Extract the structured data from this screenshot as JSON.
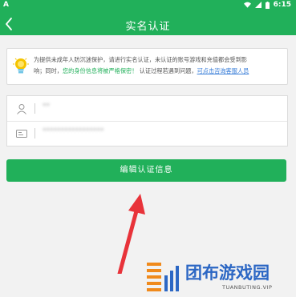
{
  "status_bar": {
    "app_indicator": "A",
    "time": "6:15",
    "icons": [
      "wifi-icon",
      "signal-icon",
      "battery-icon"
    ]
  },
  "app_bar": {
    "title": "实名认证",
    "back_icon": "chevron-left-icon"
  },
  "notice": {
    "icon": "lightbulb-icon",
    "line1": "为提供未成年人防沉迷保护，请进行实名认证，未认证的账号游戏和充值都会受到影",
    "line2_prefix": "响；同时，",
    "line2_green": "您的身份信息将被严格保密！",
    "line2_middle": " 认证过程若遇到问题，",
    "line2_link": "可点击咨询客服人员"
  },
  "form": {
    "name_icon": "person-icon",
    "name_value": "**",
    "id_icon": "id-card-icon",
    "id_value": "*****************"
  },
  "edit_button": {
    "label": "编辑认证信息"
  },
  "watermark": {
    "title": "团布游戏园",
    "subtitle": "TUANBUTING.VIP"
  },
  "colors": {
    "brand_green": "#21b05a",
    "link_blue": "#3b7fd9",
    "arrow_red": "#e8333a",
    "watermark_blue": "#2c67c4",
    "watermark_orange": "#f08a1c"
  }
}
